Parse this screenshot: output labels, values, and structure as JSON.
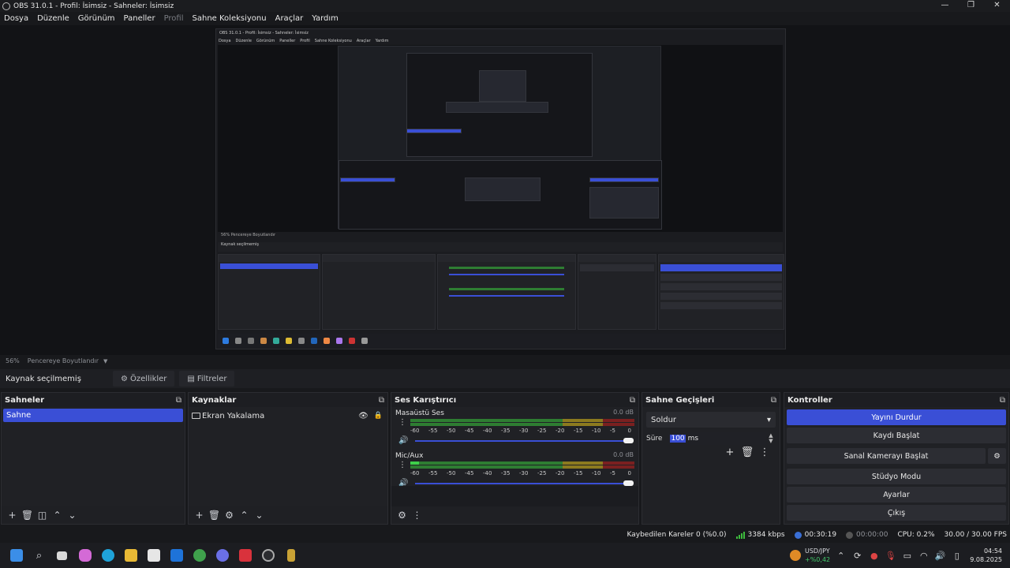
{
  "window": {
    "title": "OBS 31.0.1 - Profil: İsimsiz - Sahneler: İsimsiz",
    "controls": [
      "—",
      "❐",
      "✕"
    ]
  },
  "menu": [
    "Dosya",
    "Düzenle",
    "Görünüm",
    "Paneller",
    "Profil",
    "Sahne Koleksiyonu",
    "Araçlar",
    "Yardım"
  ],
  "preview": {
    "nested_title": "OBS 31.0.1 - Profil: İsimsiz - Sahneler: İsimsiz",
    "nested_menu": [
      "Dosya",
      "Düzenle",
      "Görünüm",
      "Paneller",
      "Profil",
      "Sahne Koleksiyonu",
      "Araçlar",
      "Yardım"
    ],
    "nested_zoom": "56%  Pencereye Boyutlandır",
    "nested_source": "Kaynak seçilmemiş"
  },
  "zoom": {
    "value": "56%",
    "label": "Pencereye Boyutlandır"
  },
  "source_toolbar": {
    "label": "Kaynak seçilmemiş",
    "properties": "Özellikler",
    "filters": "Filtreler"
  },
  "scenes": {
    "title": "Sahneler",
    "items": [
      "Sahne"
    ]
  },
  "sources": {
    "title": "Kaynaklar",
    "items": [
      "Ekran Yakalama"
    ]
  },
  "mixer": {
    "title": "Ses Karıştırıcı",
    "channels": [
      {
        "name": "Masaüstü Ses",
        "db": "0.0 dB"
      },
      {
        "name": "Mic/Aux",
        "db": "0.0 dB"
      }
    ],
    "ticks": [
      "-60",
      "-55",
      "-50",
      "-45",
      "-40",
      "-35",
      "-30",
      "-25",
      "-20",
      "-15",
      "-10",
      "-5",
      "0"
    ]
  },
  "transitions": {
    "title": "Sahne Geçişleri",
    "selected": "Soldur",
    "duration_label": "Süre",
    "duration_value": "100",
    "duration_unit": "ms"
  },
  "controls": {
    "title": "Kontroller",
    "stop_stream": "Yayını Durdur",
    "start_record": "Kaydı Başlat",
    "virtual_cam": "Sanal Kamerayı Başlat",
    "studio_mode": "Stüdyo Modu",
    "settings": "Ayarlar",
    "exit": "Çıkış"
  },
  "status": {
    "dropped": "Kaybedilen Kareler 0 (%0.0)",
    "bitrate": "3384 kbps",
    "stream_time": "00:30:19",
    "rec_time": "00:00:00",
    "cpu": "CPU: 0.2%",
    "fps": "30.00 / 30.00 FPS"
  },
  "taskbar": {
    "ticker_symbol": "USD/JPY",
    "ticker_change": "+%0,42",
    "time": "04:54",
    "date": "9.08.2025"
  },
  "colors": {
    "accent": "#3a4fd6",
    "meter_green": "#2e7d32",
    "meter_yellow": "#8c7a1f",
    "meter_red": "#7a2020"
  }
}
